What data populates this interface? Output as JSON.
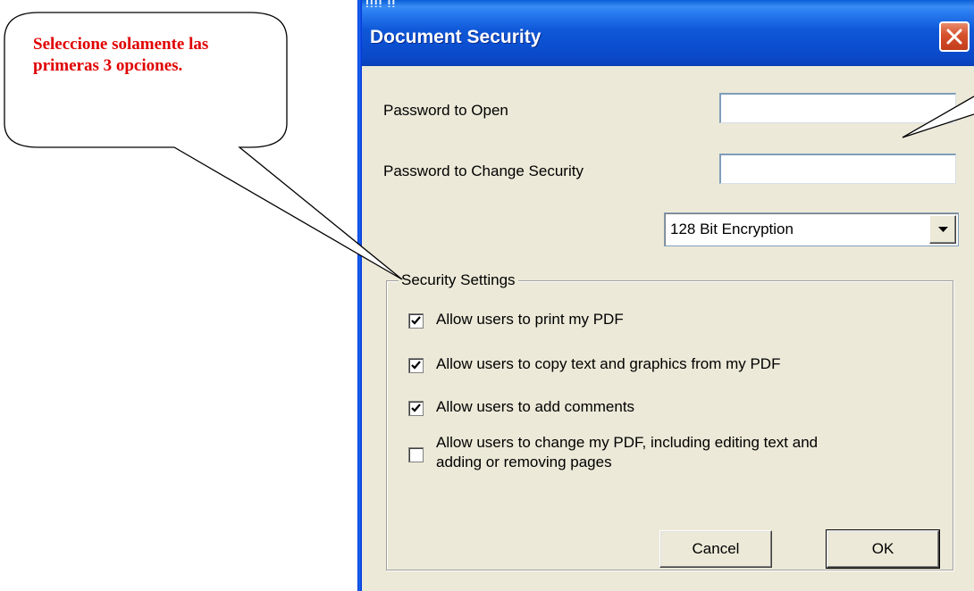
{
  "callout": {
    "text": "Seleccione solamente las primeras 3 opciones.",
    "color": "#e00000"
  },
  "window": {
    "title": "Document Security",
    "titlebar_fragment": "ᴉᴉᴉᴉ ᴉᴉ",
    "close_icon": "close-icon"
  },
  "fields": {
    "password_open_label": "Password to Open",
    "password_open_value": "",
    "password_change_label": "Password to Change Security",
    "password_change_value": ""
  },
  "encryption": {
    "selected": "128 Bit Encryption"
  },
  "security_settings": {
    "legend": "Security Settings",
    "options": [
      {
        "label": "Allow users to print my PDF",
        "checked": true
      },
      {
        "label": "Allow users to copy text and graphics from my PDF",
        "checked": true
      },
      {
        "label": "Allow users to add comments",
        "checked": true
      },
      {
        "label": "Allow users to change my PDF, including editing text and adding or removing pages",
        "checked": false
      }
    ]
  },
  "buttons": {
    "cancel": "Cancel",
    "ok": "OK"
  }
}
